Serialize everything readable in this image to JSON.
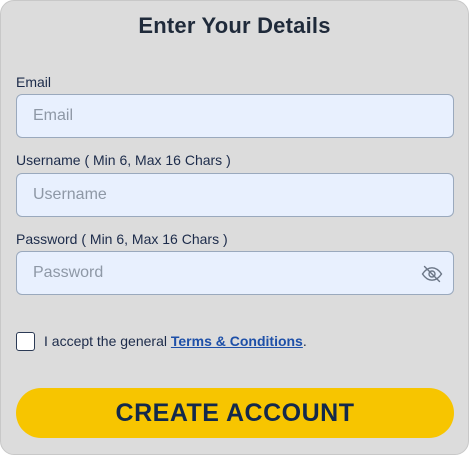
{
  "form": {
    "title": "Enter Your Details",
    "email": {
      "label": "Email",
      "placeholder": "Email",
      "value": ""
    },
    "username": {
      "label": "Username ( Min 6, Max 16 Chars )",
      "placeholder": "Username",
      "value": ""
    },
    "password": {
      "label": "Password ( Min 6, Max 16 Chars )",
      "placeholder": "Password",
      "value": "",
      "toggle_icon": "eye-slash-icon"
    },
    "terms": {
      "checked": false,
      "prefix": "I accept the general ",
      "link_text": "Terms & Conditions",
      "suffix": "."
    },
    "submit_label": "CREATE ACCOUNT"
  },
  "colors": {
    "card_background": "#dcdcdc",
    "input_background": "#e8f0fe",
    "button_background": "#f7c500",
    "button_text": "#13294b",
    "link": "#1d4fa8"
  }
}
